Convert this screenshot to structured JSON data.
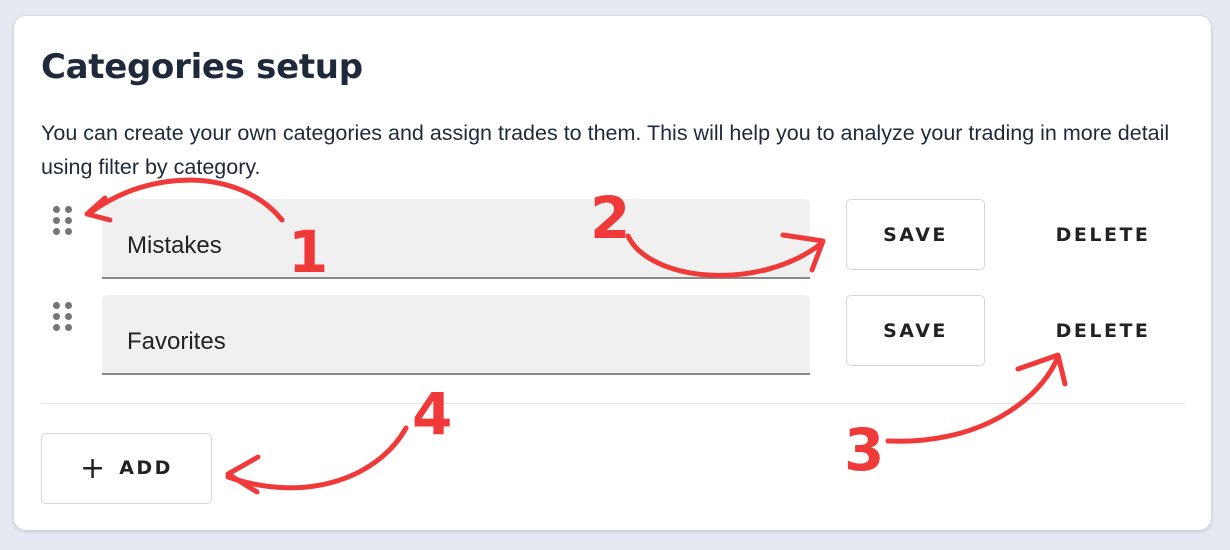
{
  "page": {
    "title": "Categories setup",
    "description": "You can create your own categories and assign trades to them. This will help you to analyze your trading in more detail using filter by category."
  },
  "categories": [
    {
      "name": "Mistakes",
      "save_label": "SAVE",
      "delete_label": "DELETE"
    },
    {
      "name": "Favorites",
      "save_label": "SAVE",
      "delete_label": "DELETE"
    }
  ],
  "add_button": {
    "icon": "+",
    "label": "ADD"
  },
  "annotations": {
    "color": "#f03a3a",
    "labels": [
      "1",
      "2",
      "3",
      "4"
    ]
  },
  "colors": {
    "background": "#e6e9f1",
    "card": "#ffffff",
    "text": "#1e293b",
    "field_bg": "#f0f0f0",
    "annotation": "#f03a3a"
  }
}
